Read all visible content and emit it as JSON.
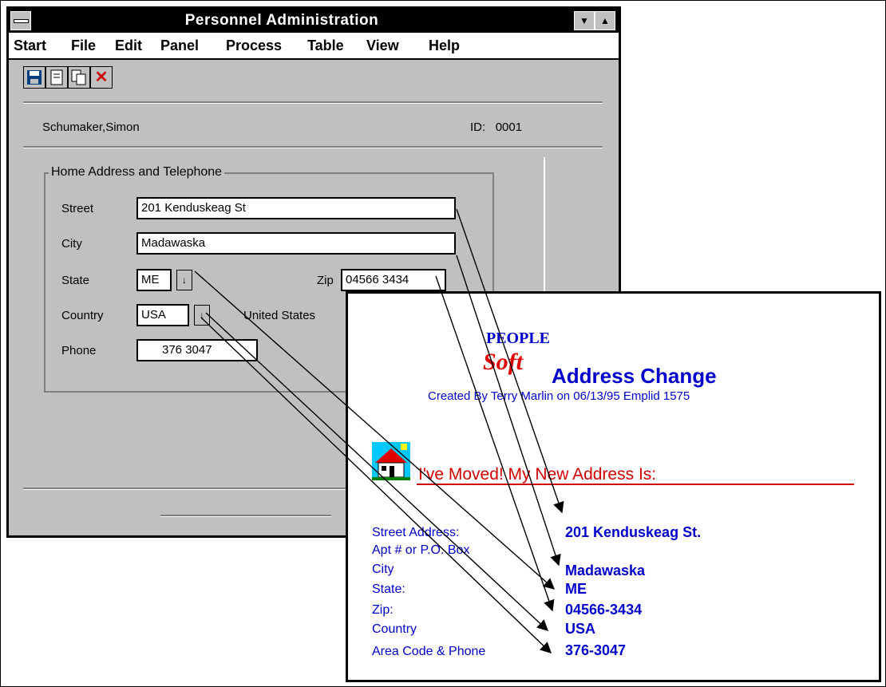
{
  "window": {
    "title": "Personnel Administration",
    "minimize_glyph": "▼",
    "maximize_glyph": "▲"
  },
  "menu": [
    "Start",
    "File",
    "Edit",
    "Panel",
    "Process",
    "Table",
    "View",
    "Help"
  ],
  "toolbar": {
    "icons": [
      "save-icon",
      "new-icon",
      "copy-icon",
      "delete-icon"
    ],
    "delete_glyph": "✕"
  },
  "employee": {
    "name": "Schumaker,Simon",
    "id_label": "ID:",
    "id_value": "0001"
  },
  "group": {
    "title": "Home Address and Telephone",
    "street_label": "Street",
    "street_value": "201 Kenduskeag St",
    "city_label": "City",
    "city_value": "Madawaska",
    "state_label": "State",
    "state_value": "ME",
    "zip_label": "Zip",
    "zip_value": "04566 3434",
    "country_label": "Country",
    "country_value": "USA",
    "country_name": "United States",
    "phone_label": "Phone",
    "phone_value": "376 3047",
    "dropdown_glyph": "↓"
  },
  "form": {
    "logo_top": "PEOPLE",
    "logo_bottom": "Soft",
    "title": "Address Change",
    "subtitle": "Created By Terry Marlin on 06/13/95   Emplid 1575",
    "heading": "I've Moved!  My New Address Is:",
    "labels": {
      "street": "Street Address:",
      "apt": "Apt # or P.O. Box",
      "city": "City",
      "state": "State:",
      "zip": "Zip:",
      "country": "Country",
      "phone": "Area Code & Phone"
    },
    "values": {
      "street": "201 Kenduskeag St.",
      "city": "Madawaska",
      "state": "ME",
      "zip": "04566-3434",
      "country": "USA",
      "phone": "376-3047"
    }
  }
}
